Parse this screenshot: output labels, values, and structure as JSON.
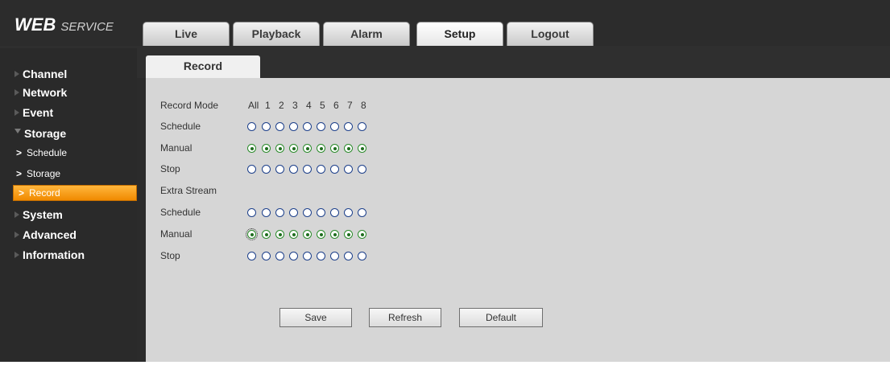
{
  "logo": {
    "main": "WEB",
    "sub": "SERVICE"
  },
  "tabs": [
    {
      "label": "Live",
      "active": false
    },
    {
      "label": "Playback",
      "active": false
    },
    {
      "label": "Alarm",
      "active": false
    },
    {
      "label": "Setup",
      "active": true
    },
    {
      "label": "Logout",
      "active": false
    }
  ],
  "sidebar": {
    "items": [
      {
        "label": "Channel",
        "expanded": false
      },
      {
        "label": "Network",
        "expanded": false
      },
      {
        "label": "Event",
        "expanded": false
      },
      {
        "label": "Storage",
        "expanded": true
      },
      {
        "label": "Schedule",
        "sub": true
      },
      {
        "label": "Storage",
        "sub": true
      },
      {
        "label": "Record",
        "sub": true,
        "active": true
      },
      {
        "label": "System",
        "expanded": false
      },
      {
        "label": "Advanced",
        "expanded": false
      },
      {
        "label": "Information",
        "expanded": false
      }
    ]
  },
  "content": {
    "tab_label": "Record",
    "record_mode_label": "Record Mode",
    "columns": [
      "All",
      "1",
      "2",
      "3",
      "4",
      "5",
      "6",
      "7",
      "8"
    ],
    "main_rows": [
      {
        "label": "Schedule",
        "selected": false
      },
      {
        "label": "Manual",
        "selected": true
      },
      {
        "label": "Stop",
        "selected": false
      }
    ],
    "extra_stream_label": "Extra Stream",
    "extra_rows": [
      {
        "label": "Schedule",
        "selected": false
      },
      {
        "label": "Manual",
        "selected": true
      },
      {
        "label": "Stop",
        "selected": false
      }
    ]
  },
  "buttons": {
    "save": "Save",
    "refresh": "Refresh",
    "default": "Default"
  },
  "colors": {
    "accent": "#f08a00",
    "panel": "#d6d6d6",
    "dark": "#2b2b2b"
  }
}
